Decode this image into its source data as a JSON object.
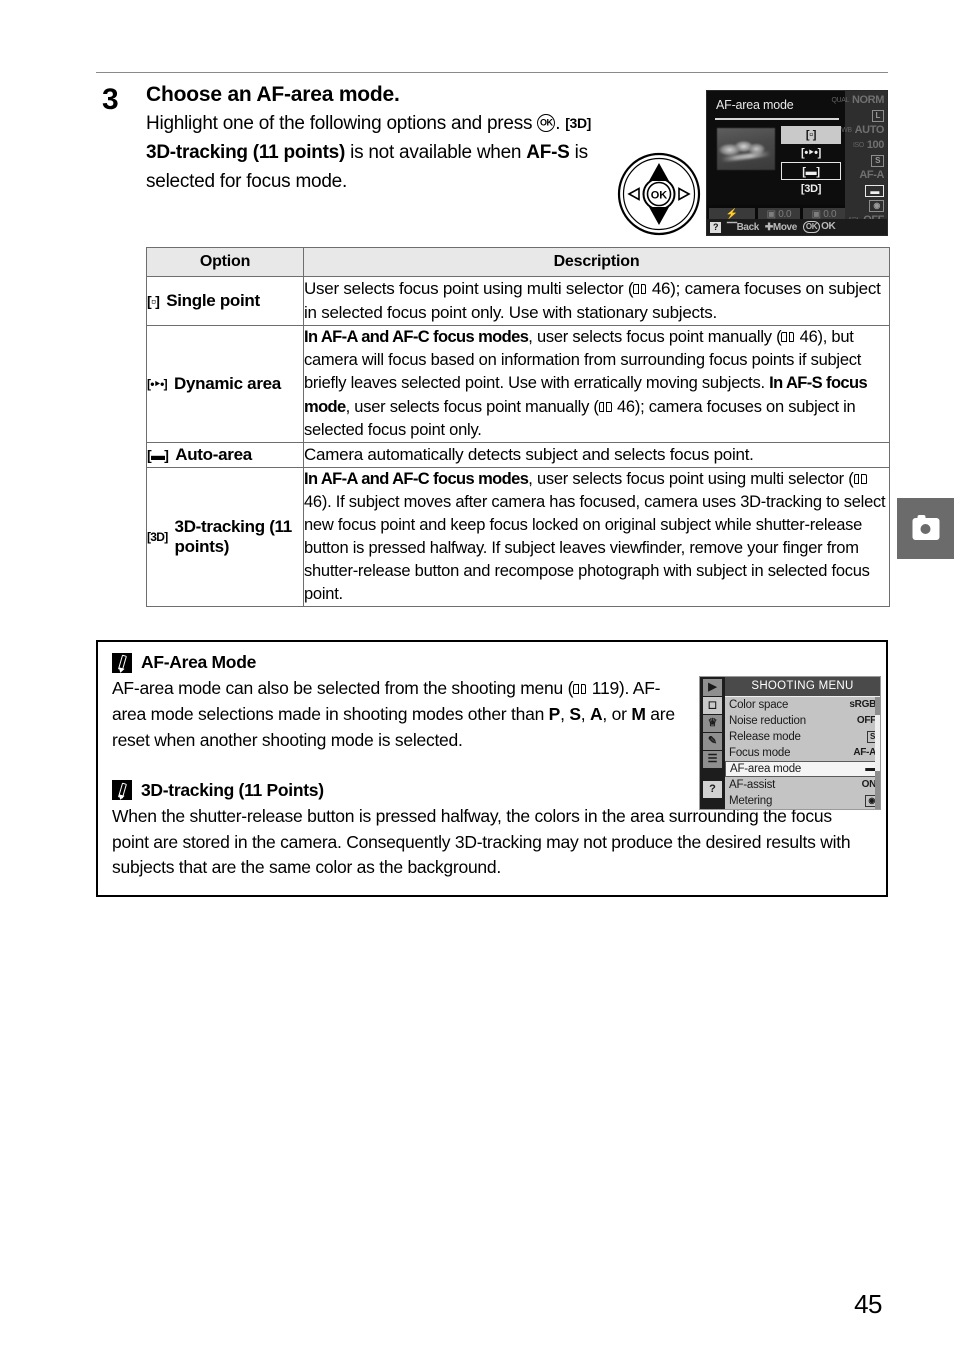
{
  "page": {
    "number": "45"
  },
  "step": {
    "number": "3",
    "title": "Choose an AF-area mode.",
    "text_part1": "Highlight one of the following options and press ",
    "text_ok_suffix": ". ",
    "icon_3d": "[3D]",
    "text_bold_3d": "3D-tracking (11 points)",
    "text_part2": " is not available when ",
    "text_bold_afs": "AF-S",
    "text_part3": " is selected for focus mode."
  },
  "lcd": {
    "title": "AF-area mode",
    "options": [
      {
        "glyph": "[ ]",
        "state": "selected"
      },
      {
        "glyph": "[ ]",
        "state": "normal"
      },
      {
        "glyph": "[ ]",
        "state": "boxed"
      },
      {
        "glyph": "[3D]",
        "state": "normal"
      }
    ],
    "exposure": [
      {
        "label": "flash",
        "value": ""
      },
      {
        "label": "exp-comp",
        "value": "0.0"
      },
      {
        "label": "flash-comp",
        "value": "0.0"
      }
    ],
    "sidebar": [
      {
        "label": "QUAL",
        "value": "NORM"
      },
      {
        "label": "",
        "value": "L"
      },
      {
        "label": "WB",
        "value": "AUTO"
      },
      {
        "label": "ISO",
        "value": "100"
      },
      {
        "label": "",
        "value": "S"
      },
      {
        "label": "",
        "value": "AF-A"
      },
      {
        "label": "",
        "value": "[ ]"
      },
      {
        "label": "",
        "value": "metering"
      },
      {
        "label": "ADL",
        "value": "OFF"
      }
    ],
    "bottom_bar": {
      "help": "?",
      "back": "Back",
      "move": "Move",
      "ok": "OK"
    }
  },
  "table": {
    "headers": [
      "Option",
      "Description"
    ],
    "rows": [
      {
        "icon": "[ ]",
        "label": "Single point",
        "desc_html": "User selects focus point using multi selector (<span class=\"book\"></span> 46); camera focuses on subject in selected focus point only.  Use with stationary subjects."
      },
      {
        "icon": "[ ]",
        "label": "Dynamic area",
        "desc_html": "<b>In AF-A and AF-C focus modes</b>, user selects focus point manually (<span class=\"book\"></span> 46), but camera will focus based on information from surrounding focus points if subject briefly leaves selected point.  Use with erratically moving subjects.  <b>In AF-S focus mode</b>, user selects focus point manually (<span class=\"book\"></span> 46); camera focuses on subject in selected focus point only."
      },
      {
        "icon": "[ ]",
        "label": "Auto-area",
        "desc_html": "Camera automatically detects subject and selects focus point."
      },
      {
        "icon": "[3D]",
        "label": "3D-tracking (11 points)",
        "desc_html": "<b>In AF-A and AF-C focus modes</b>, user selects focus point using multi selector (<span class=\"book\"></span> 46).  If subject moves after camera has focused, camera uses 3D-tracking to select new focus point and keep focus locked on original subject while shutter-release button is pressed halfway.  If subject leaves viewfinder, remove your finger from shutter-release button and recompose photograph with subject in selected focus point."
      }
    ]
  },
  "notes": [
    {
      "title": "AF-Area Mode",
      "body_html": "AF-area mode can also be selected from the shooting menu (<span class=\"book\"></span> 119). AF-area mode selections made in shooting modes other than <b>P</b>, <b>S</b>, <b>A</b>, or <b>M</b> are reset when another shooting mode is selected."
    },
    {
      "title": "3D-tracking (11 Points)",
      "body_html": "When the shutter-release button is pressed halfway, the colors in the area surrounding the focus point are stored in the camera.  Consequently 3D-tracking may not produce the desired results with subjects that are the same color as the background."
    }
  ],
  "shooting_menu": {
    "title": "SHOOTING MENU",
    "tabs": [
      "playback-icon",
      "shooting-icon",
      "setup-icon",
      "retouch-icon",
      "recent-icon",
      "help-icon"
    ],
    "rows": [
      {
        "name": "Color space",
        "value": "sRGB",
        "boxed": false,
        "selected": false
      },
      {
        "name": "Noise reduction",
        "value": "OFF",
        "boxed": false,
        "selected": false
      },
      {
        "name": "Release mode",
        "value": "S",
        "boxed": true,
        "selected": false
      },
      {
        "name": "Focus mode",
        "value": "AF-A",
        "boxed": false,
        "selected": false
      },
      {
        "name": "AF-area mode",
        "value": "[ ]",
        "boxed": false,
        "selected": true
      },
      {
        "name": "AF-assist",
        "value": "ON",
        "boxed": false,
        "selected": false
      },
      {
        "name": "Metering",
        "value": "",
        "boxed": true,
        "selected": false
      }
    ]
  },
  "side_tab": {
    "icon": "camera-icon"
  }
}
